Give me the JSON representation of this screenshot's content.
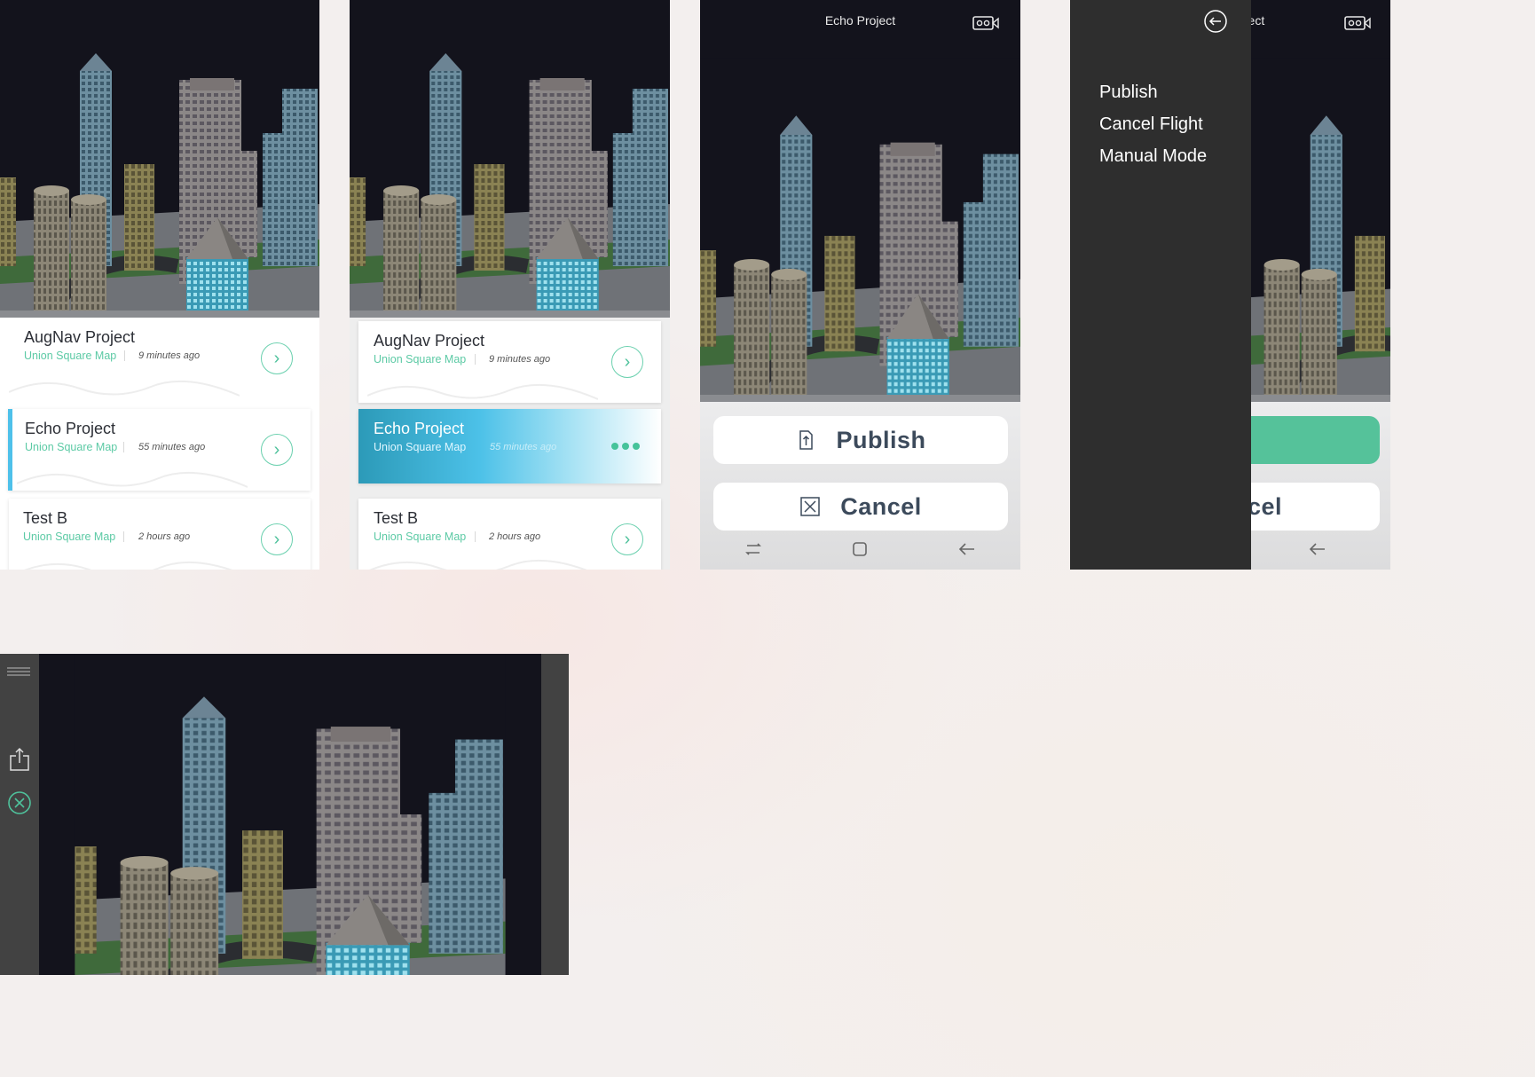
{
  "screen1": {
    "cards": [
      {
        "title": "AugNav Project",
        "subtitle": "Union Square Map",
        "time": "9 minutes ago"
      },
      {
        "title": "Echo Project",
        "subtitle": "Union Square Map",
        "time": "55 minutes ago"
      },
      {
        "title": "Test B",
        "subtitle": "Union Square Map",
        "time": "2 hours ago"
      }
    ]
  },
  "screen2": {
    "cards": [
      {
        "title": "AugNav Project",
        "subtitle": "Union Square Map",
        "time": "9 minutes ago"
      },
      {
        "title": "Echo Project",
        "subtitle": "Union Square Map",
        "time": "55 minutes ago"
      },
      {
        "title": "Test B",
        "subtitle": "Union Square Map",
        "time": "2 hours ago"
      }
    ]
  },
  "screen3": {
    "title": "Echo Project",
    "publish_label": "Publish",
    "cancel_label": "Cancel"
  },
  "screen4": {
    "title_fragment": "roject",
    "menu": [
      "Publish",
      "Cancel Flight",
      "Manual Mode"
    ],
    "cancel_fragment": "cel"
  },
  "colors": {
    "accent_green": "#4fc29c",
    "accent_blue": "#4ec1ea",
    "scene_bg": "#13131c",
    "drawer_bg": "#2e2e2e"
  },
  "icons": {
    "list_row": "chevron-right-icon",
    "selected_row": "more-dots-icon",
    "header": "vr-headset-icon",
    "publish": "upload-file-icon",
    "cancel": "close-box-icon",
    "drawer_back": "back-circle-icon",
    "nav": [
      "recent-apps-icon",
      "home-icon",
      "back-arrow-icon"
    ],
    "rail": [
      "menu-icon",
      "share-icon",
      "close-circle-icon"
    ]
  }
}
